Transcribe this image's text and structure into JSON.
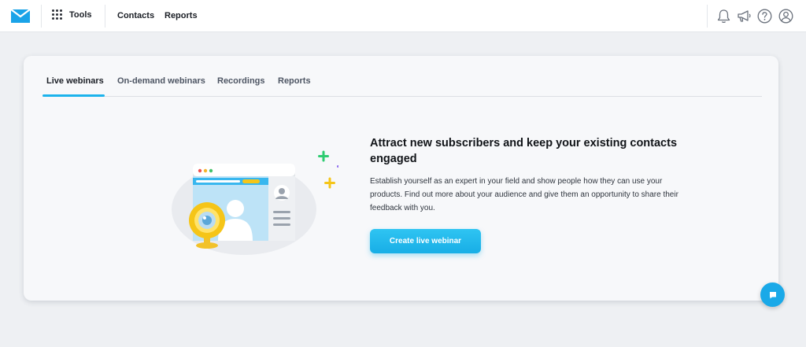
{
  "topbar": {
    "logo_icon": "envelope-logo-icon",
    "tools_label": "Tools",
    "nav": [
      {
        "label": "Contacts"
      },
      {
        "label": "Reports"
      }
    ],
    "icons": [
      "bell-icon",
      "megaphone-icon",
      "help-icon",
      "account-icon"
    ]
  },
  "tabs": [
    {
      "label": "Live webinars",
      "active": true
    },
    {
      "label": "On-demand webinars",
      "active": false
    },
    {
      "label": "Recordings",
      "active": false
    },
    {
      "label": "Reports",
      "active": false
    }
  ],
  "main": {
    "heading": "Attract new subscribers and keep your existing contacts engaged",
    "description": "Establish yourself as an expert in your field and show people how they can use your products. Find out more about your audience and give them an opportunity to share their feedback with you.",
    "cta_label": "Create live webinar"
  },
  "chat_icon": "chat-icon",
  "colors": {
    "accent": "#1cb3ec",
    "logo": "#1aa3e8",
    "plus_green": "#2ecc71",
    "plus_purple": "#8e6cf0",
    "plus_yellow": "#f5c518"
  }
}
